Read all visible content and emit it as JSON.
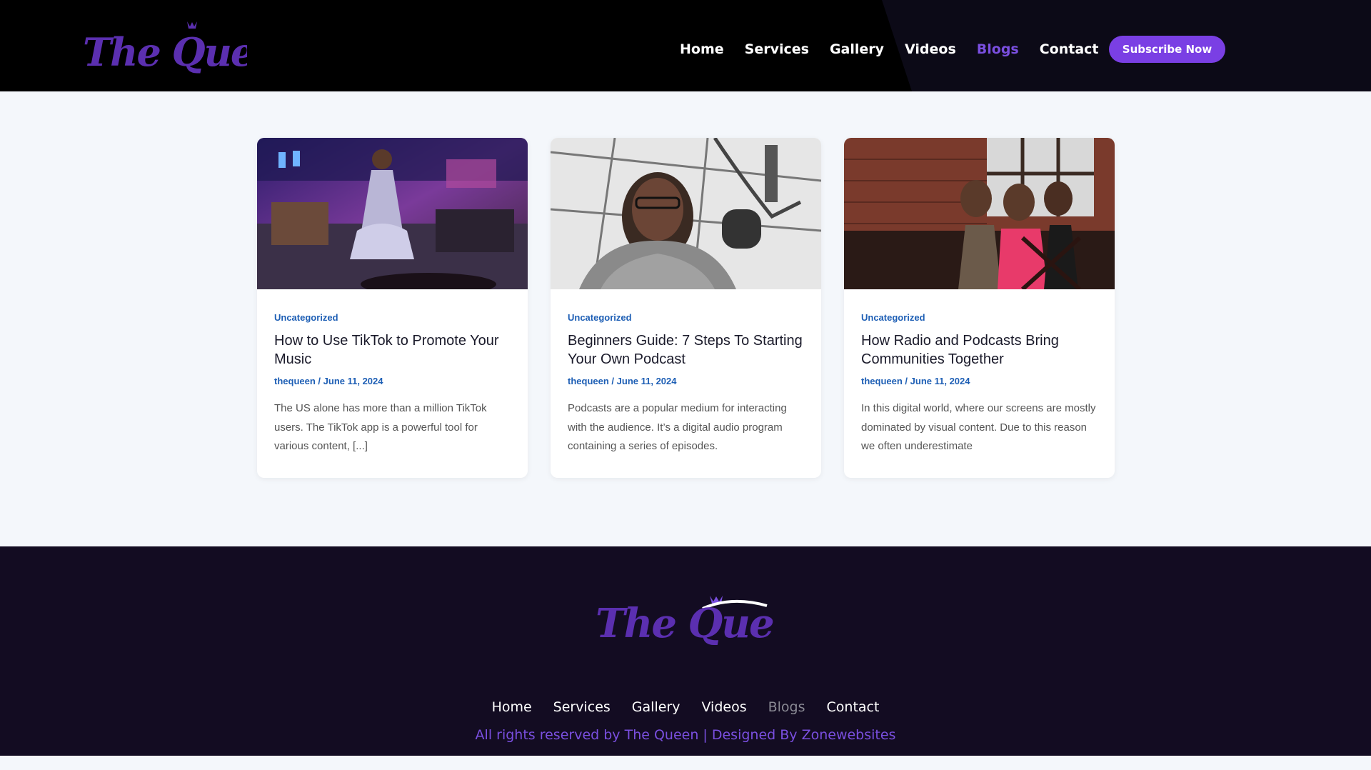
{
  "brand": {
    "logo_text": "The Queen"
  },
  "header": {
    "nav": [
      {
        "label": "Home"
      },
      {
        "label": "Services"
      },
      {
        "label": "Gallery"
      },
      {
        "label": "Videos"
      },
      {
        "label": "Blogs",
        "active": true
      },
      {
        "label": "Contact"
      }
    ],
    "subscribe_label": "Subscribe Now"
  },
  "posts": [
    {
      "category": "Uncategorized",
      "title": "How to Use TikTok to Promote Your Music",
      "author": "thequeen",
      "date": "June 11, 2024",
      "excerpt": "The US alone has more than a million TikTok users. The TikTok app is a powerful tool for various content, [...]",
      "image": "performer-on-stage-photo"
    },
    {
      "category": "Uncategorized",
      "title": "Beginners Guide: 7 Steps To Starting Your Own Podcast",
      "author": "thequeen",
      "date": "June 11, 2024",
      "excerpt": "Podcasts are a popular medium for interacting with the audience. It’s a digital audio program containing a series of episodes.",
      "image": "woman-at-microphone-photo"
    },
    {
      "category": "Uncategorized",
      "title": "How Radio and Podcasts Bring Communities Together",
      "author": "thequeen",
      "date": "June 11, 2024",
      "excerpt": "In this digital world, where our screens are mostly dominated by visual content. Due to this reason we often underestimate",
      "image": "group-at-dinner-table-photo"
    }
  ],
  "footer": {
    "nav": [
      {
        "label": "Home"
      },
      {
        "label": "Services"
      },
      {
        "label": "Gallery"
      },
      {
        "label": "Videos"
      },
      {
        "label": "Blogs",
        "active": true
      },
      {
        "label": "Contact"
      }
    ],
    "copyright": "All rights reserved by The Queen | Designed By Zonewebsites"
  },
  "colors": {
    "accent": "#7a3fe4",
    "link_blue": "#1e5fb5",
    "header_bg": "#000000",
    "footer_bg": "#130c22",
    "page_bg": "#f4f7fb"
  }
}
